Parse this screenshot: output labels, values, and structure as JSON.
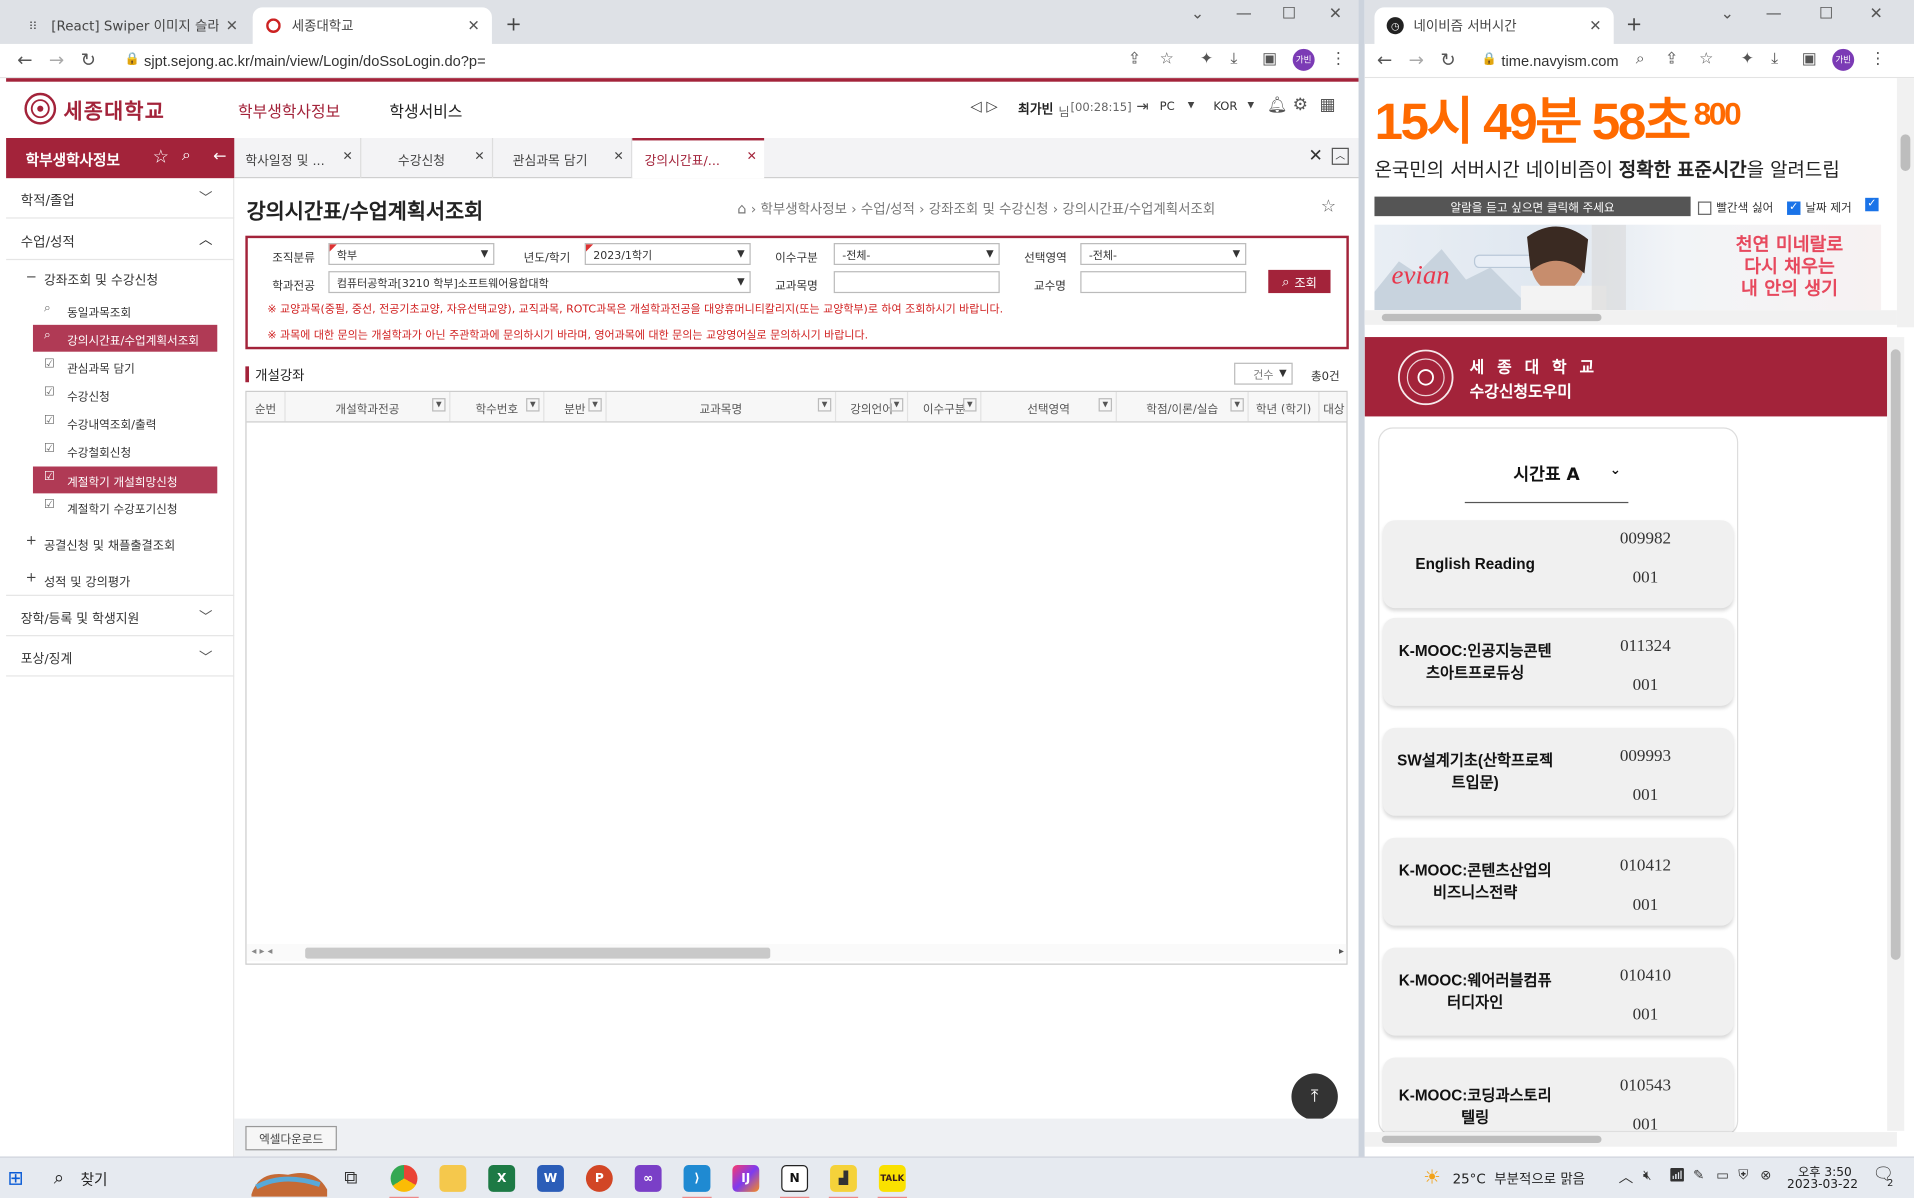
{
  "left_browser": {
    "tabs": [
      {
        "title": "[React] Swiper 이미지 슬라이드",
        "favicon": "tistory"
      },
      {
        "title": "세종대학교",
        "favicon": "sejong",
        "active": true
      }
    ],
    "url": "sjpt.sejong.ac.kr/main/view/Login/doSsoLogin.do?p=",
    "profile": "가빈"
  },
  "portal": {
    "logo_text": "세종대학교",
    "topmenu": [
      "학부생학사정보",
      "학생서비스"
    ],
    "user": {
      "name": "최가빈",
      "suffix": "님",
      "timer": "[00:28:15]",
      "device": "PC",
      "lang": "KOR"
    },
    "side_title": "학부생학사정보",
    "tabs": [
      "학사일정 및 ...",
      "수강신청",
      "관심과목 담기",
      "강의시간표/..."
    ],
    "sidebar": {
      "groups": [
        "학적/졸업",
        "수업/성적",
        "장학/등록 및 학생지원",
        "포상/징계"
      ],
      "subgroup": "강좌조회 및 수강신청",
      "items": [
        "동일과목조회",
        "강의시간표/수업계획서조회",
        "관심과목 담기",
        "수강신청",
        "수강내역조회/출력",
        "수강철회신청",
        "계절학기 개설희망신청",
        "계절학기 수강포기신청"
      ],
      "subgroups2": [
        "공결신청 및 채플출결조회",
        "성적 및 강의평가"
      ]
    },
    "page_title": "강의시간표/수업계획서조회",
    "breadcrumb": [
      "학부생학사정보",
      "수업/성적",
      "강좌조회 및 수강신청",
      "강의시간표/수업계획서조회"
    ],
    "form": {
      "org_label": "조직분류",
      "org_value": "학부",
      "year_label": "년도/학기",
      "year_value": "2023/1학기",
      "type_label": "이수구분",
      "type_value": "-전체-",
      "area_label": "선택영역",
      "area_value": "-전체-",
      "dept_label": "학과전공",
      "dept_value": "컴퓨터공학과[3210 학부]소프트웨어융합대학",
      "course_label": "교과목명",
      "course_value": "",
      "prof_label": "교수명",
      "prof_value": "",
      "search_btn": "조회",
      "note1": "※ 교양과목(중필, 중선, 전공기초교양, 자유선택교양), 교직과목, ROTC과목은 개설학과전공을 대양휴머니티칼리지(또는 교양학부)로 하여 조회하시기 바랍니다.",
      "note2": "※ 과목에 대한 문의는 개설학과가 아닌 주관학과에 문의하시기 바라며, 영어과목에 대한 문의는 교양영어실로 문의하시기 바랍니다."
    },
    "section_title": "개설강좌",
    "count_select": "건수",
    "count_text": "총0건",
    "grid_headers": [
      "순번",
      "개설학과전공",
      "학수번호",
      "분반",
      "교과목명",
      "강의언어",
      "이수구분",
      "선택영역",
      "학점/이론/실습",
      "학년 (학기)",
      "대상"
    ],
    "excel_btn": "엑셀다운로드"
  },
  "right_browser": {
    "tab_title": "네이비즘 서버시간",
    "url": "time.navyism.com",
    "clock_text": "15시 49분 58초",
    "clock_ms": "800",
    "tagline_pre": "온국민의 서버시간 네이비즘이 ",
    "tagline_b1": "정확한",
    "tagline_mid": " ",
    "tagline_b2": "표준시간",
    "tagline_post": "을 알려드립",
    "alarm_btn": "알람을 듣고 싶으면 클릭해 주세요",
    "check1": "빨간색 싫어",
    "check2": "날짜 제거",
    "ad_brand": "evian",
    "ad_copy": [
      "천연 미네랄로",
      "다시 채우는",
      "내 안의 생기"
    ],
    "helper_title1": "세 종 대 학 교",
    "helper_title2": "수강신청도우미",
    "timetable_label": "시간표 A",
    "courses": [
      {
        "name": "English Reading",
        "code": "009982",
        "section": "001"
      },
      {
        "name": "K-MOOC:인공지능콘텐츠아트프로듀싱",
        "code": "011324",
        "section": "001"
      },
      {
        "name": "SW설계기초(산학프로젝트입문)",
        "code": "009993",
        "section": "001"
      },
      {
        "name": "K-MOOC:콘텐츠산업의비즈니스전략",
        "code": "010412",
        "section": "001"
      },
      {
        "name": "K-MOOC:웨어러블컴퓨터디자인",
        "code": "010410",
        "section": "001"
      },
      {
        "name": "K-MOOC:코딩과스토리텔링",
        "code": "010543",
        "section": "001"
      }
    ]
  },
  "taskbar": {
    "search_label": "찾기",
    "weather": "25°C  부분적으로 맑음",
    "time": "오후 3:50",
    "date": "2023-03-22",
    "notif": "2"
  },
  "colors": {
    "brand": "#a3233a",
    "accent_dark": "#b03a55",
    "note_red": "#d02020"
  }
}
